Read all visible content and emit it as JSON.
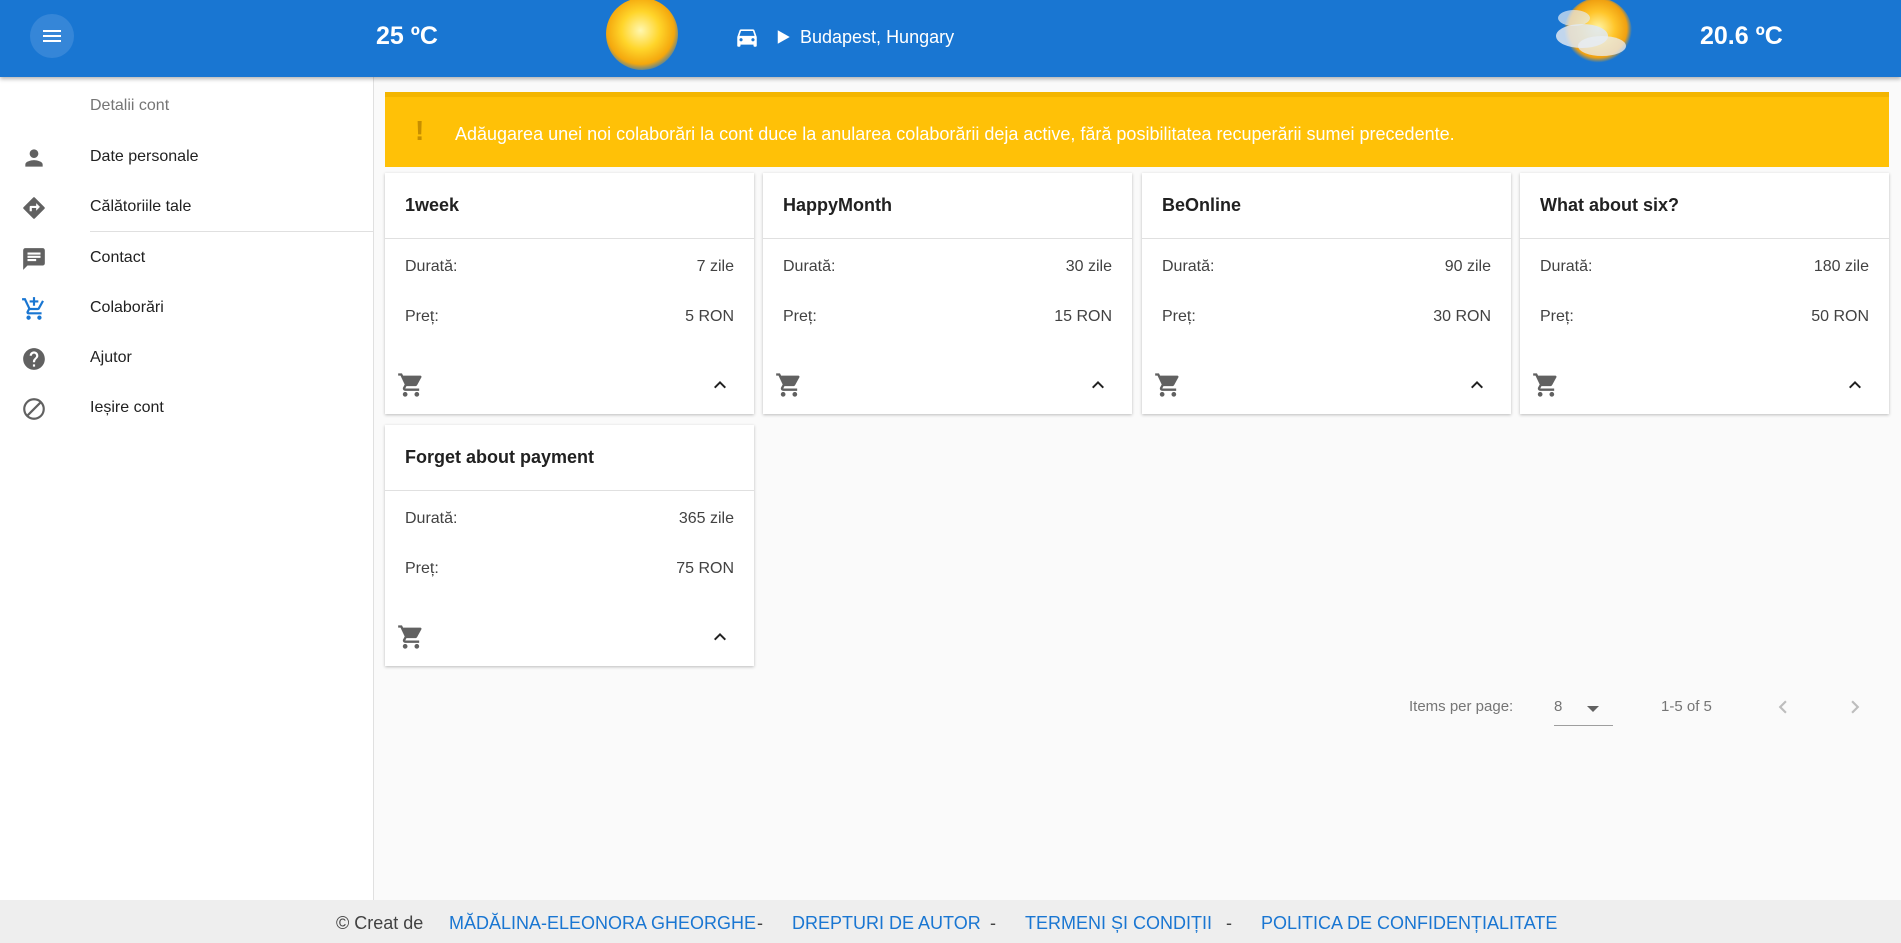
{
  "header": {
    "temp_local": "25 ºC",
    "location": "Budapest, Hungary",
    "temp_destination": "20.6 ºC",
    "icons": [
      "menu-icon",
      "sun-icon",
      "car-icon",
      "play-arrow-icon",
      "partly-cloudy-icon"
    ]
  },
  "sidebar": {
    "heading": "Detalii cont",
    "items": [
      {
        "label": "Date personale",
        "icon": "person-icon"
      },
      {
        "label": "Călătoriile tale",
        "icon": "directions-icon"
      },
      {
        "label": "Contact",
        "icon": "chat-icon"
      },
      {
        "label": "Colaborări",
        "icon": "add-shopping-cart-icon",
        "active": true
      },
      {
        "label": "Ajutor",
        "icon": "help-icon"
      },
      {
        "label": "Ieșire cont",
        "icon": "block-icon"
      }
    ]
  },
  "banner": {
    "icon": "!",
    "message": "Adăugarea unei noi colaborări la cont duce la anularea colaborării deja active, fără posibilitatea recuperării sumei precedente."
  },
  "cards": [
    {
      "title": "1week",
      "duration_label": "Durată:",
      "duration": "7 zile",
      "price_label": "Preț:",
      "price": "5 RON"
    },
    {
      "title": "HappyMonth",
      "duration_label": "Durată:",
      "duration": "30 zile",
      "price_label": "Preț:",
      "price": "15 RON"
    },
    {
      "title": "BeOnline",
      "duration_label": "Durată:",
      "duration": "90 zile",
      "price_label": "Preț:",
      "price": "30 RON"
    },
    {
      "title": "What about six?",
      "duration_label": "Durată:",
      "duration": "180 zile",
      "price_label": "Preț:",
      "price": "50 RON"
    },
    {
      "title": "Forget about payment",
      "duration_label": "Durată:",
      "duration": "365 zile",
      "price_label": "Preț:",
      "price": "75 RON"
    }
  ],
  "paginator": {
    "items_per_page_label": "Items per page:",
    "items_per_page": "8",
    "range": "1-5 of 5"
  },
  "footer": {
    "created_by": "© Creat de",
    "author": "MĂDĂLINA-ELEONORA GHEORGHE",
    "sep": "-",
    "copyright": "DREPTURI DE AUTOR",
    "terms": "TERMENI ȘI CONDIȚII",
    "privacy": "POLITICA DE CONFIDENȚIALITATE"
  },
  "colors": {
    "primary": "#1976d2",
    "warning": "#ffc107",
    "active_icon": "#1976d2"
  }
}
